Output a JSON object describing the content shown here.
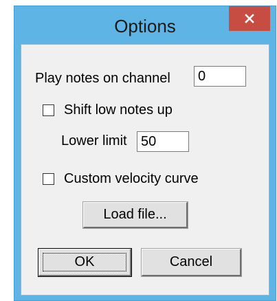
{
  "window": {
    "title": "Options",
    "close_glyph": "✕"
  },
  "channel": {
    "label": "Play notes on channel",
    "value": "0"
  },
  "shift": {
    "label": "Shift low notes up",
    "checked": false,
    "lower_limit_label": "Lower limit",
    "lower_limit_value": "50"
  },
  "velocity": {
    "label": "Custom velocity curve",
    "checked": false,
    "load_button_label": "Load file..."
  },
  "actions": {
    "ok_label": "OK",
    "cancel_label": "Cancel"
  },
  "colors": {
    "frame": "#5fb4e6",
    "close_button": "#c74c42",
    "client": "#f0f0f0"
  }
}
